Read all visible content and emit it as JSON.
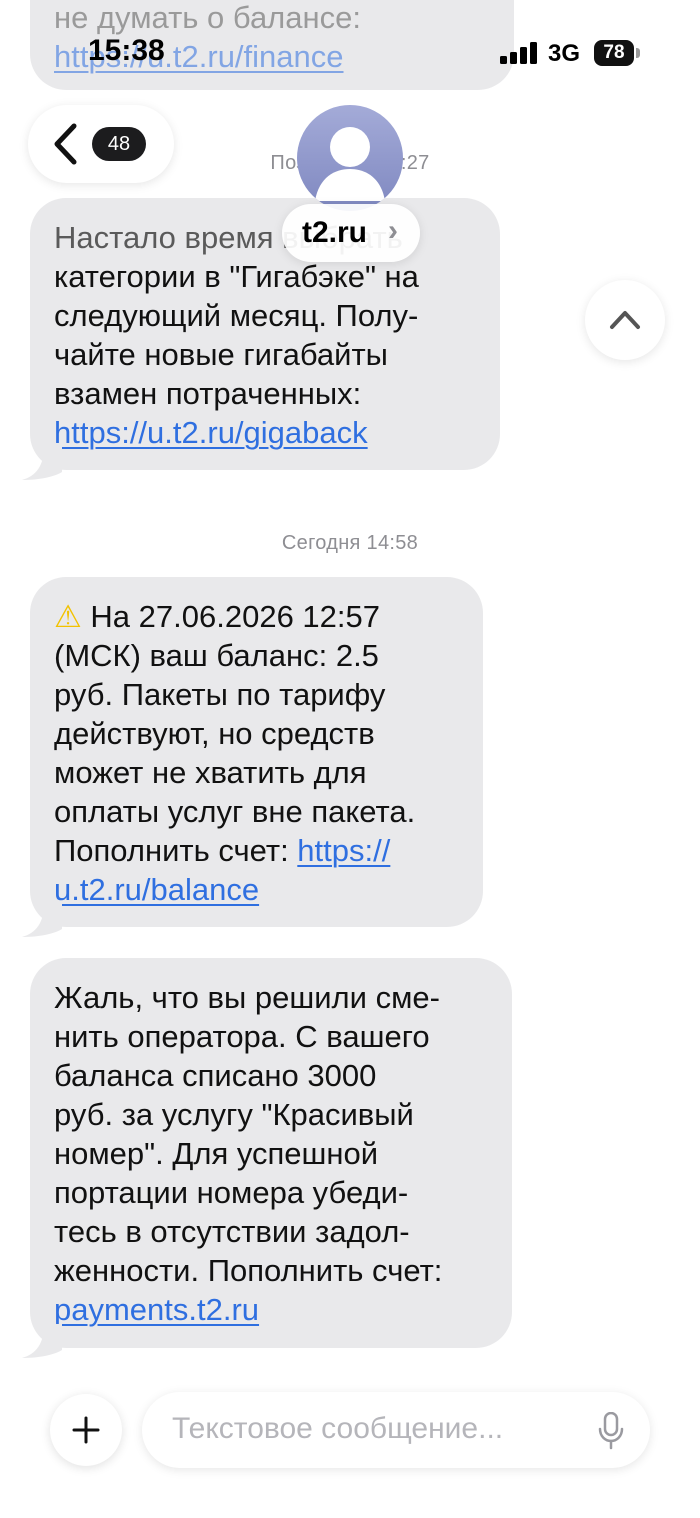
{
  "status_bar": {
    "time": "15:38",
    "network": "3G",
    "battery": "78"
  },
  "header": {
    "back_count": "48",
    "contact_name": "t2.ru",
    "contact_chevron": "›"
  },
  "messages": {
    "top_partial": {
      "line1": "не думать о балансе:",
      "link": "https://u.t2.ru/finance"
    },
    "timestamp_earlier": "Позавчера 10:27",
    "gigaback": {
      "line1": "Настало время выбрать",
      "line2": "категории в \"Гигабэке\" на",
      "line3": "следующий месяц. Полу-",
      "line4": "чайте новые гигабайты",
      "line5": "взамен потраченных:",
      "link": "https://u.t2.ru/gigaback"
    },
    "timestamp_today": "Сегодня 14:58",
    "balance": {
      "warning_icon": "⚠",
      "line1": "На 27.06.2026 12:57",
      "line2": "(МСК) ваш баланс: 2.5",
      "line3": "руб. Пакеты по тарифу",
      "line4": "действуют, но средств",
      "line5": "может не хватить для",
      "line6": "оплаты услуг вне пакета.",
      "line7": "Пополнить счет: ",
      "link_part1": "https://",
      "link_part2": "u.t2.ru/balance"
    },
    "operator": {
      "line1": "Жаль, что вы решили сме-",
      "line2": "нить оператора. С вашего",
      "line3": "баланса списано 3000",
      "line4": "руб. за услугу \"Красивый",
      "line5": "номер\". Для успешной",
      "line6": "портации номера убеди-",
      "line7": "тесь в отсутствии задол-",
      "line8": "женности. Пополнить счет:",
      "link": "payments.t2.ru"
    }
  },
  "composer": {
    "placeholder": "Текстовое сообщение..."
  },
  "colors": {
    "bubble": "#e9e9eb",
    "link": "#2f6fe0",
    "accent_avatar": "#8e97c9"
  }
}
